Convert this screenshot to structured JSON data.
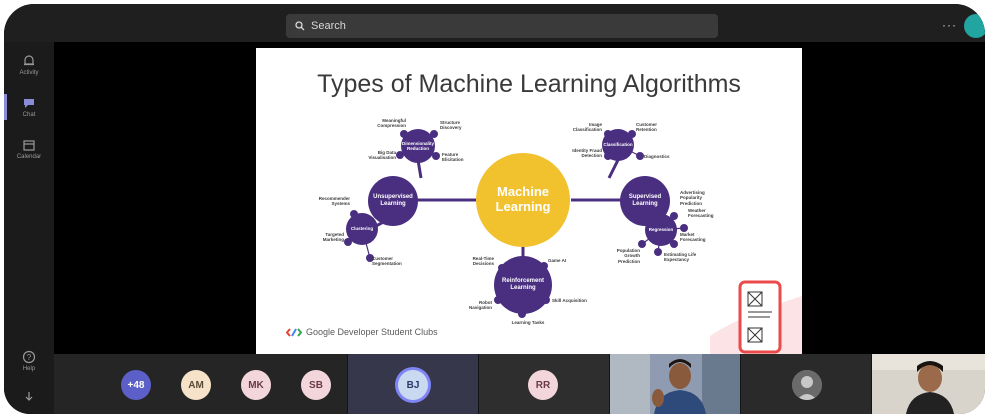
{
  "search": {
    "placeholder": "Search"
  },
  "window": {
    "more_label": "···"
  },
  "rail": {
    "items": [
      {
        "label": "Activity",
        "icon": "bell-icon"
      },
      {
        "label": "Chat",
        "icon": "chat-icon"
      },
      {
        "label": "Calendar",
        "icon": "calendar-icon"
      },
      {
        "label": "Help",
        "icon": "help-icon"
      }
    ]
  },
  "slide": {
    "title": "Types of Machine Learning Algorithms",
    "footer": "Google Developer Student Clubs",
    "center": "Machine Learning",
    "branches": [
      {
        "label": "Unsupervised Learning"
      },
      {
        "label": "Supervised Learning"
      },
      {
        "label": "Reinforcement Learning"
      }
    ],
    "subnodes": [
      {
        "label": "Dimensionality Reduction"
      },
      {
        "label": "Clustering"
      },
      {
        "label": "Classification"
      },
      {
        "label": "Regression"
      }
    ],
    "leaves": [
      "Meaningful Compression",
      "Structure Discovery",
      "Big Data Visualisation",
      "Feature Elicitation",
      "Recommender Systems",
      "Targeted Marketing",
      "Customer Segmentation",
      "Image Classification",
      "Customer Retention",
      "Identity Fraud Detection",
      "Diagnostics",
      "Advertising Popularity Prediction",
      "Weather Forecasting",
      "Market Forecasting",
      "Population Growth Prediction",
      "Estimating Life Expectancy",
      "Real-Time Decisions",
      "Game AI",
      "Robot Navigation",
      "Skill Acquisition",
      "Learning Tasks"
    ]
  },
  "participants": {
    "overflow": "+48",
    "initials": [
      "AM",
      "MK",
      "SB",
      "BJ",
      "RR"
    ]
  },
  "colors": {
    "accent": "#8a8cd8",
    "node_purple": "#4a2f80",
    "center_yellow": "#f2c12e"
  }
}
